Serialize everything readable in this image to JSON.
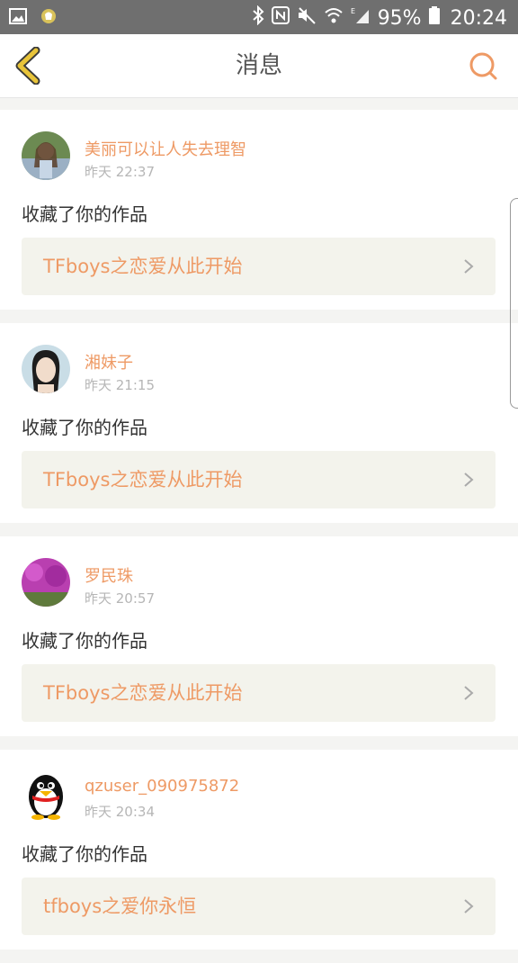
{
  "statusbar": {
    "battery": "95%",
    "time": "20:24"
  },
  "header": {
    "title": "消息"
  },
  "colors": {
    "accent": "#ee9a65",
    "back": "#e8c43a"
  },
  "messages": [
    {
      "username": "美丽可以让人失去理智",
      "time": "昨天 22:37",
      "action": "收藏了你的作品",
      "work": "TFboys之恋爱从此开始"
    },
    {
      "username": "湘妹子",
      "time": "昨天 21:15",
      "action": "收藏了你的作品",
      "work": "TFboys之恋爱从此开始"
    },
    {
      "username": "罗民珠",
      "time": "昨天 20:57",
      "action": "收藏了你的作品",
      "work": "TFboys之恋爱从此开始"
    },
    {
      "username": "qzuser_090975872",
      "time": "昨天 20:34",
      "action": "收藏了你的作品",
      "work": "tfboys之爱你永恒"
    }
  ]
}
